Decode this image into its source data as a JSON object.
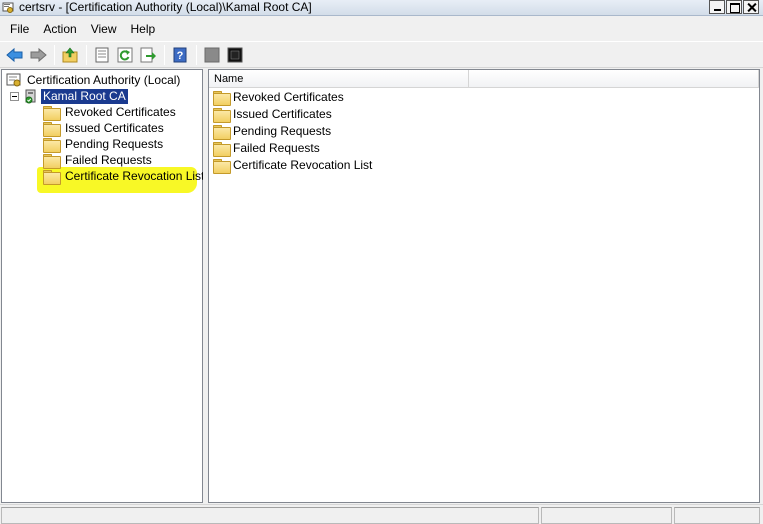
{
  "window": {
    "title": "certsrv - [Certification Authority (Local)\\Kamal Root CA]"
  },
  "menu": {
    "items": [
      "File",
      "Action",
      "View",
      "Help"
    ]
  },
  "toolbar": {
    "buttons": [
      "back-arrow-icon",
      "forward-arrow-icon",
      "up-folder-icon",
      "properties-icon",
      "refresh-icon",
      "export-list-icon",
      "help-icon",
      "start-service-icon",
      "stop-service-icon"
    ]
  },
  "tree": {
    "root": "Certification Authority (Local)",
    "ca": "Kamal Root CA",
    "children": [
      "Revoked Certificates",
      "Issued Certificates",
      "Pending Requests",
      "Failed Requests",
      "Certificate Revocation List"
    ]
  },
  "list": {
    "columns": [
      "Name",
      ""
    ],
    "rows": [
      "Revoked Certificates",
      "Issued Certificates",
      "Pending Requests",
      "Failed Requests",
      "Certificate Revocation List"
    ]
  },
  "colors": {
    "highlight": "#f7f700",
    "selection": "#1a3a8f",
    "folder": "#f2cf62"
  }
}
